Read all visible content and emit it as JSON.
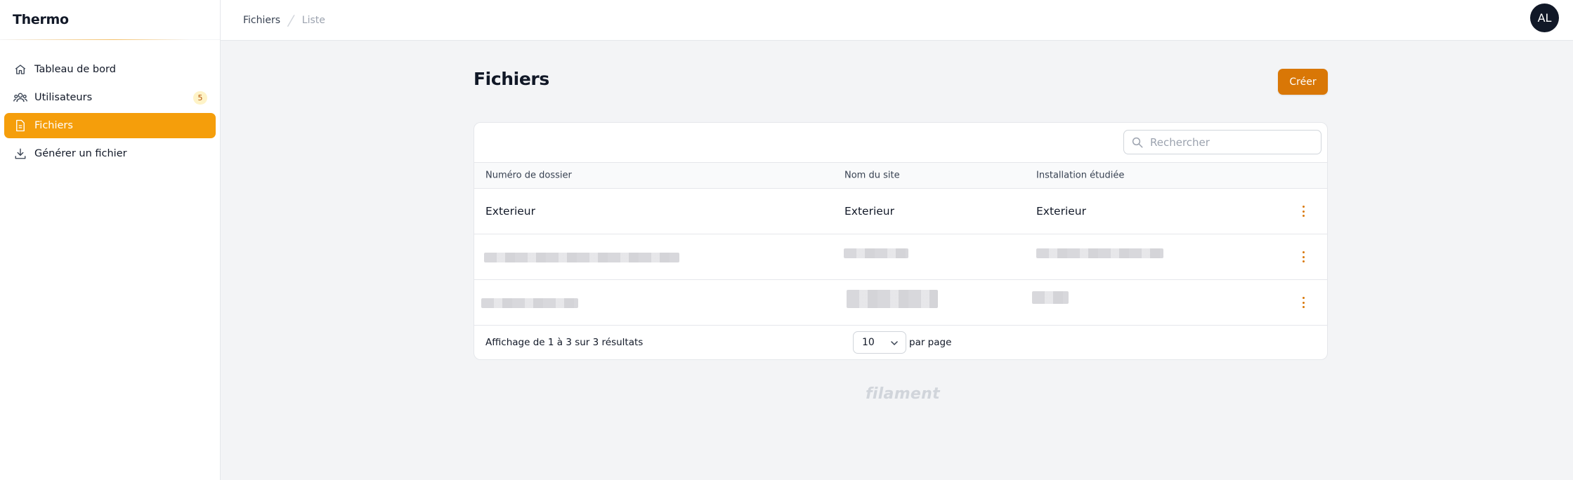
{
  "brand": "Thermo",
  "sidebar": {
    "items": [
      {
        "label": "Tableau de bord",
        "icon": "home-icon"
      },
      {
        "label": "Utilisateurs",
        "icon": "users-icon",
        "badge": "5"
      },
      {
        "label": "Fichiers",
        "icon": "document-icon",
        "active": true
      },
      {
        "label": "Générer un fichier",
        "icon": "download-icon"
      }
    ]
  },
  "breadcrumb": {
    "first": "Fichiers",
    "second": "Liste"
  },
  "user": {
    "initials": "AL"
  },
  "page": {
    "title": "Fichiers",
    "create_label": "Créer"
  },
  "search": {
    "placeholder": "Rechercher",
    "value": ""
  },
  "table": {
    "columns": [
      "Numéro de dossier",
      "Nom du site",
      "Installation étudiée"
    ],
    "rows": [
      {
        "numero": "Exterieur",
        "site": "Exterieur",
        "installation": "Exterieur"
      },
      {
        "numero": "",
        "site": "",
        "installation": ""
      },
      {
        "numero": "",
        "site": "",
        "installation": ""
      }
    ],
    "summary": "Affichage de 1 à 3 sur 3 résultats",
    "per_page_value": "10",
    "per_page_label": "par page"
  },
  "footer": {
    "brand": "filament"
  },
  "colors": {
    "accent": "#f59e0b",
    "accent_dark": "#d97706",
    "avatar_bg": "#111827"
  }
}
